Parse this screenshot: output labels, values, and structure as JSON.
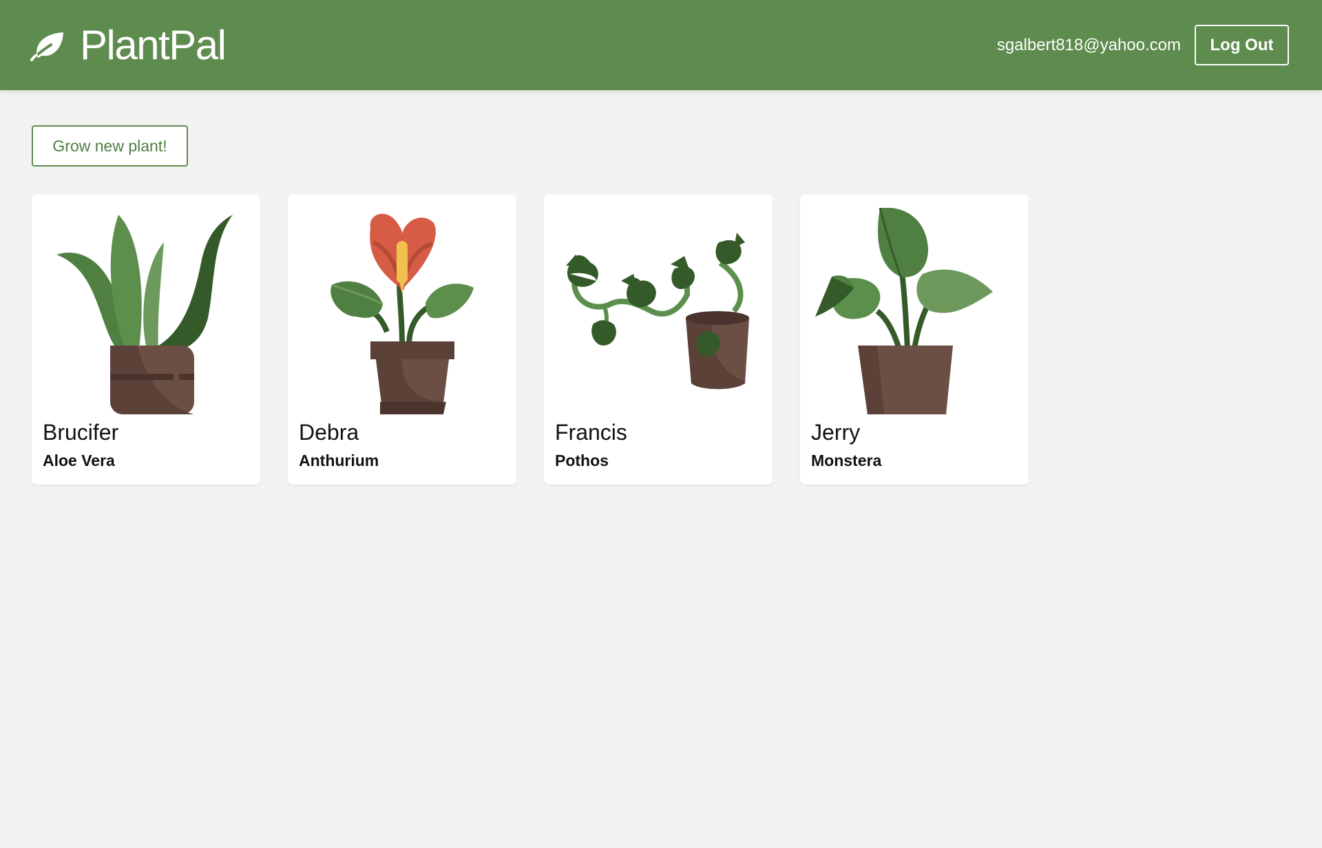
{
  "header": {
    "brand_name": "PlantPal",
    "brand_icon": "leaf-icon",
    "user_email": "sgalbert818@yahoo.com",
    "logout_label": "Log Out"
  },
  "main": {
    "grow_button_label": "Grow new plant!",
    "plants": [
      {
        "name": "Brucifer",
        "species": "Aloe Vera",
        "icon": "aloe-vera-icon"
      },
      {
        "name": "Debra",
        "species": "Anthurium",
        "icon": "anthurium-icon"
      },
      {
        "name": "Francis",
        "species": "Pothos",
        "icon": "pothos-icon"
      },
      {
        "name": "Jerry",
        "species": "Monstera",
        "icon": "monstera-icon"
      }
    ]
  },
  "colors": {
    "brand_green": "#5e8b4e",
    "background": "#f2f2f2",
    "pot_brown": "#6b4f44",
    "leaf_dark": "#355a2a",
    "leaf_mid": "#4f8041",
    "leaf_light": "#6d9a5c",
    "flower_red": "#d65c45"
  }
}
